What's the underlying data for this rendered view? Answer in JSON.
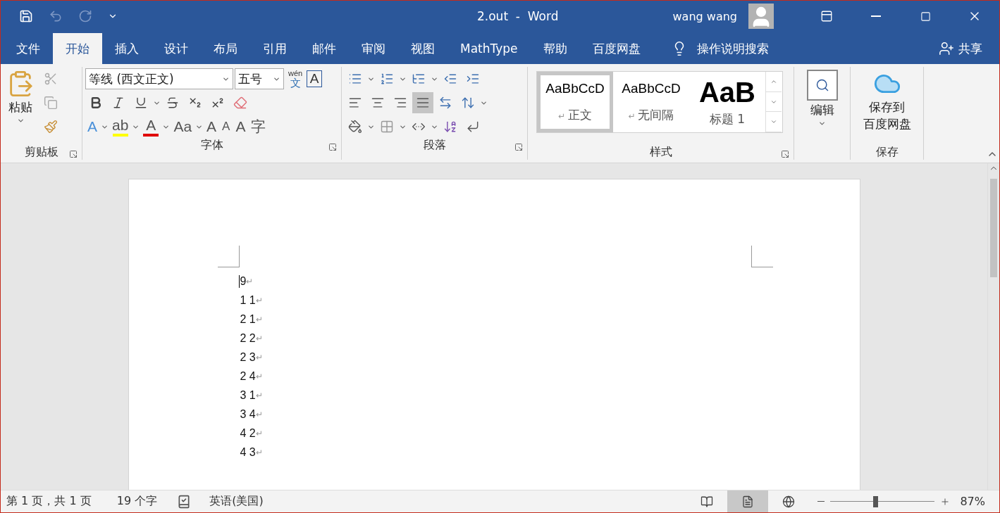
{
  "window": {
    "title": "2.out  -  Word",
    "user": "wang wang"
  },
  "tabs": [
    {
      "label": "文件",
      "selected": false
    },
    {
      "label": "开始",
      "selected": true
    },
    {
      "label": "插入",
      "selected": false
    },
    {
      "label": "设计",
      "selected": false
    },
    {
      "label": "布局",
      "selected": false
    },
    {
      "label": "引用",
      "selected": false
    },
    {
      "label": "邮件",
      "selected": false
    },
    {
      "label": "审阅",
      "selected": false
    },
    {
      "label": "视图",
      "selected": false
    },
    {
      "label": "MathType",
      "selected": false
    },
    {
      "label": "帮助",
      "selected": false
    },
    {
      "label": "百度网盘",
      "selected": false
    }
  ],
  "tell_me": "操作说明搜索",
  "share": "共享",
  "clipboard": {
    "label": "剪贴板",
    "paste": "粘贴"
  },
  "font": {
    "label": "字体",
    "font_name": "等线 (西文正文)",
    "font_size": "五号",
    "phonetic_top": "wén",
    "phonetic_bottom": "文",
    "border_glyph": "A",
    "glyph_buttons": [
      {
        "kind": "effect",
        "glyph": "A"
      },
      {
        "kind": "highlight",
        "glyph": "ab"
      },
      {
        "kind": "color",
        "glyph": "A"
      },
      {
        "kind": "case",
        "glyph": "Aa"
      },
      {
        "kind": "grow",
        "glyph": "A"
      },
      {
        "kind": "shrink",
        "glyph": "A"
      },
      {
        "kind": "shade",
        "glyph": "A"
      },
      {
        "kind": "enclose",
        "glyph": "字"
      }
    ]
  },
  "paragraph": {
    "label": "段落",
    "alignment": [
      {
        "selected": false
      },
      {
        "selected": false
      },
      {
        "selected": false
      },
      {
        "selected": true
      },
      {
        "selected": false
      }
    ]
  },
  "styles": {
    "label": "样式",
    "items": [
      {
        "preview": "AaBbCcD",
        "mark": "↵",
        "name": "正文",
        "selected": true,
        "kind": "body"
      },
      {
        "preview": "AaBbCcD",
        "mark": "↵",
        "name": "无间隔",
        "selected": false,
        "kind": "body"
      },
      {
        "preview": "AaB",
        "name": "标题 1",
        "selected": false,
        "kind": "heading"
      }
    ]
  },
  "editing": {
    "label": "编辑"
  },
  "save": {
    "button_lines": [
      "保存到",
      "百度网盘"
    ],
    "label": "保存"
  },
  "document": {
    "lines": [
      {
        "text": "9",
        "mark": "↵"
      },
      {
        "text": "1 1",
        "mark": "↵"
      },
      {
        "text": "2 1",
        "mark": "↵"
      },
      {
        "text": "2 2",
        "mark": "↵"
      },
      {
        "text": "2 3",
        "mark": "↵"
      },
      {
        "text": "2 4",
        "mark": "↵"
      },
      {
        "text": "3 1",
        "mark": "↵"
      },
      {
        "text": "3 4",
        "mark": "↵"
      },
      {
        "text": "4 2",
        "mark": "↵"
      },
      {
        "text": "4 3",
        "mark": "↵"
      }
    ]
  },
  "status_bar": {
    "page": "第 1 页，共 1 页",
    "words": "19 个字",
    "language": "英语(美国)",
    "views": [
      {
        "kind": "read",
        "selected": false
      },
      {
        "kind": "print",
        "selected": true
      },
      {
        "kind": "web",
        "selected": false
      }
    ],
    "zoom": {
      "level": 0.43,
      "reading": "87%"
    }
  }
}
